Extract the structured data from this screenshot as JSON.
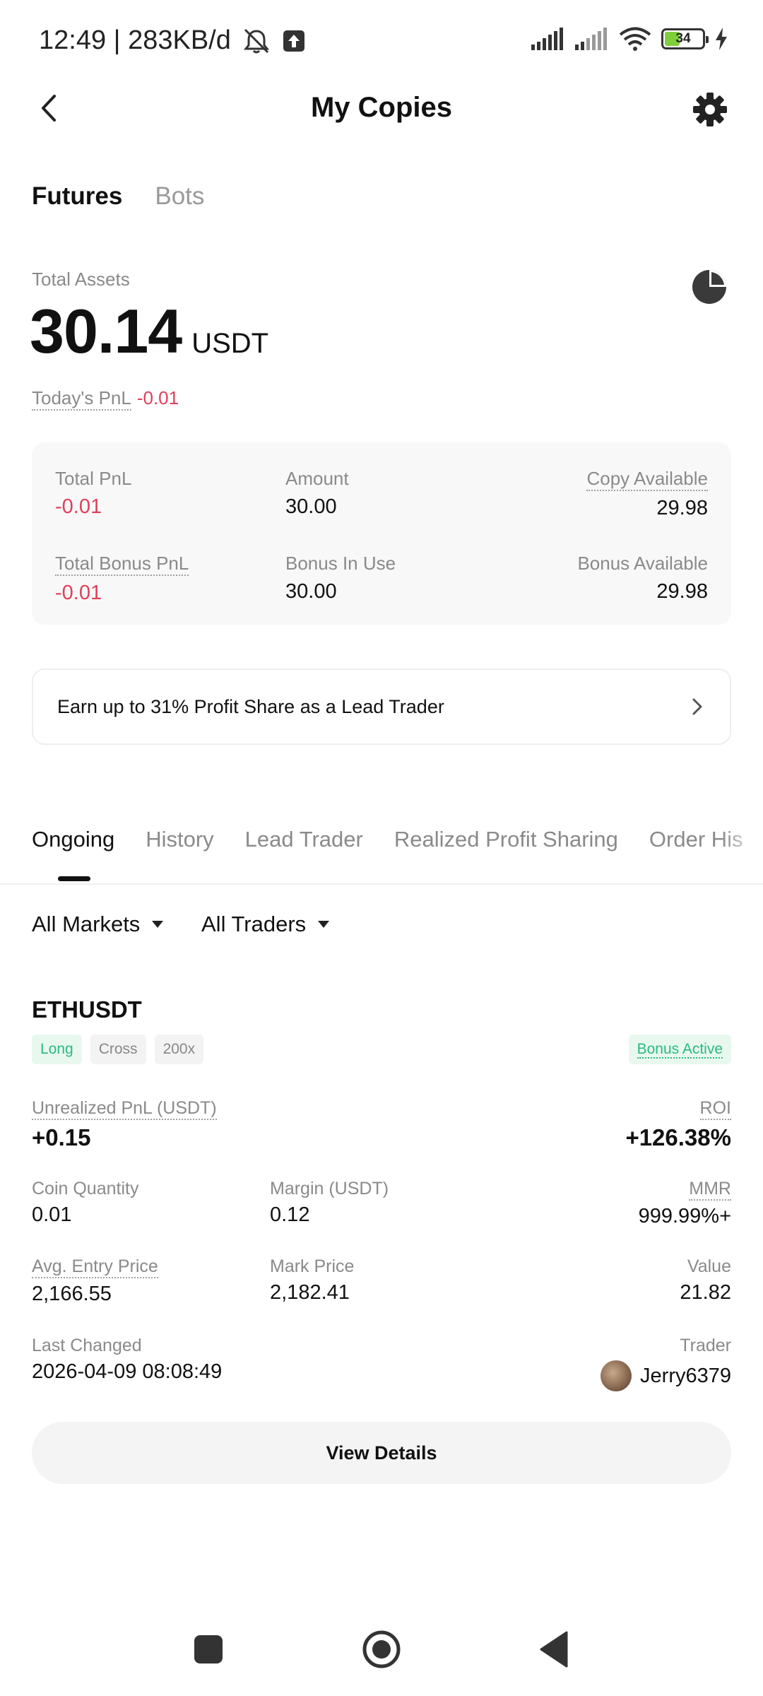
{
  "status_bar": {
    "time_speed": "12:49 | 283KB/d",
    "battery": "34"
  },
  "header": {
    "title": "My Copies"
  },
  "asset_tabs": [
    {
      "label": "Futures",
      "active": true
    },
    {
      "label": "Bots",
      "active": false
    }
  ],
  "assets": {
    "total_label": "Total Assets",
    "total_value": "30.14",
    "currency": "USDT",
    "today_pnl_label": "Today's PnL",
    "today_pnl_value": "-0.01"
  },
  "summary": {
    "total_pnl_label": "Total PnL",
    "total_pnl_value": "-0.01",
    "amount_label": "Amount",
    "amount_value": "30.00",
    "copy_available_label": "Copy Available",
    "copy_available_value": "29.98",
    "total_bonus_pnl_label": "Total Bonus PnL",
    "total_bonus_pnl_value": "-0.01",
    "bonus_in_use_label": "Bonus In Use",
    "bonus_in_use_value": "30.00",
    "bonus_available_label": "Bonus Available",
    "bonus_available_value": "29.98"
  },
  "banner": {
    "text": "Earn up to 31% Profit Share as a Lead Trader"
  },
  "position_tabs": [
    {
      "label": "Ongoing",
      "active": true
    },
    {
      "label": "History",
      "active": false
    },
    {
      "label": "Lead Trader",
      "active": false
    },
    {
      "label": "Realized Profit Sharing",
      "active": false
    },
    {
      "label": "Order His",
      "active": false
    }
  ],
  "filters": {
    "markets": "All Markets",
    "traders": "All Traders"
  },
  "position": {
    "symbol": "ETHUSDT",
    "tags": [
      "Long",
      "Cross",
      "200x"
    ],
    "bonus_tag": "Bonus Active",
    "unrealized_pnl_label": "Unrealized PnL (USDT)",
    "unrealized_pnl_value": "+0.15",
    "roi_label": "ROI",
    "roi_value": "+126.38%",
    "coin_qty_label": "Coin Quantity",
    "coin_qty_value": "0.01",
    "margin_label": "Margin (USDT)",
    "margin_value": "0.12",
    "mmr_label": "MMR",
    "mmr_value": "999.99%+",
    "entry_label": "Avg. Entry Price",
    "entry_value": "2,166.55",
    "mark_label": "Mark Price",
    "mark_value": "2,182.41",
    "value_label": "Value",
    "value_value": "21.82",
    "last_changed_label": "Last Changed",
    "last_changed_value": "2026-04-09 08:08:49",
    "trader_label": "Trader",
    "trader_name": "Jerry6379"
  },
  "view_details": "View Details",
  "colors": {
    "negative": "#e0405a",
    "positive": "#2bb982",
    "card_bg": "#f8f8f8"
  },
  "icons": [
    "back-arrow-icon",
    "gear-icon",
    "pie-chart-icon",
    "chevron-right-icon",
    "caret-down-icon",
    "mute-icon",
    "upload-icon",
    "signal-icon",
    "wifi-icon",
    "battery-icon",
    "charging-icon"
  ]
}
